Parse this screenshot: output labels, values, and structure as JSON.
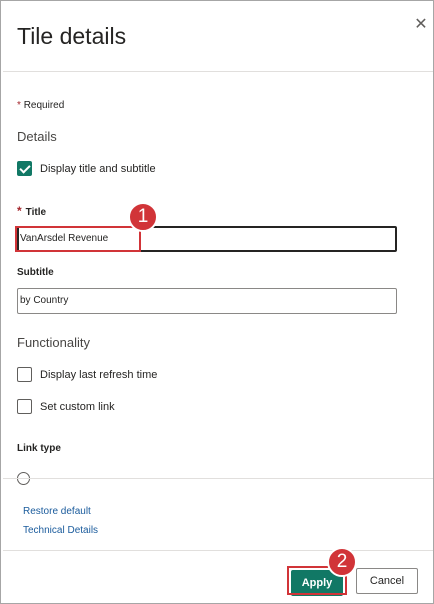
{
  "dialog": {
    "title": "Tile details",
    "close_glyph": "✕"
  },
  "form": {
    "required_marker": "*",
    "required_text": "Required",
    "details_heading": "Details",
    "display_title_checkbox": {
      "label": "Display title and subtitle",
      "checked": true
    },
    "title_field": {
      "label": "Title",
      "value": "VanArsdel Revenue"
    },
    "subtitle_field": {
      "label": "Subtitle",
      "value": "by Country"
    },
    "functionality_heading": "Functionality",
    "refresh_checkbox": {
      "label": "Display last refresh time",
      "checked": false
    },
    "custom_link_checkbox": {
      "label": "Set custom link",
      "checked": false
    },
    "link_type_label": "Link type"
  },
  "footer_links": {
    "restore_default": "Restore default",
    "technical_details": "Technical Details"
  },
  "buttons": {
    "apply": "Apply",
    "cancel": "Cancel"
  },
  "annotations": {
    "step1": "1",
    "step2": "2"
  },
  "colors": {
    "accent": "#117865",
    "annotation": "#d13438",
    "link": "#1a5b9c"
  },
  "icons": {
    "close": "close-icon",
    "check": "checkmark-icon"
  }
}
